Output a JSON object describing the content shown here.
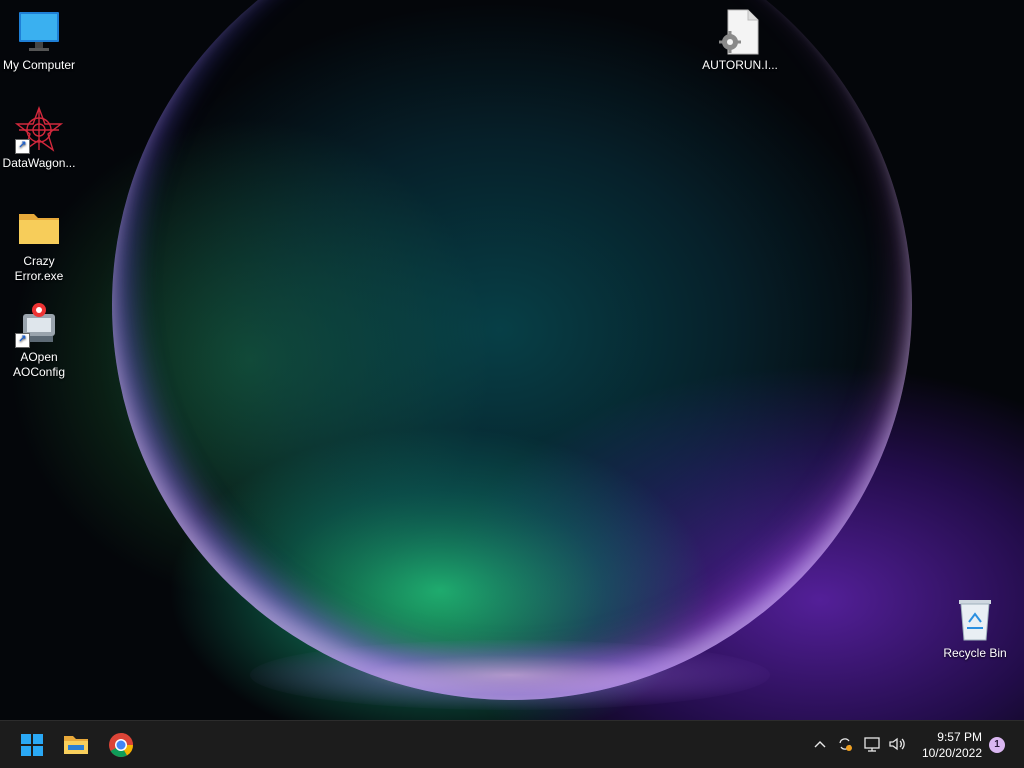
{
  "desktop": {
    "icons": [
      {
        "label": "My Computer",
        "icon": "monitor-icon"
      },
      {
        "label": "DataWagon...",
        "icon": "datawagon-star-icon"
      },
      {
        "label": "Crazy Error.exe",
        "icon": "folder-icon"
      },
      {
        "label": "AOpen AOConfig",
        "icon": "aopen-config-icon"
      },
      {
        "label": "AUTORUN.I...",
        "icon": "settings-file-icon"
      },
      {
        "label": "Recycle Bin",
        "icon": "recycle-bin-icon"
      }
    ]
  },
  "taskbar": {
    "start_icon": "windows-logo-icon",
    "pinned": [
      "file-explorer-icon",
      "chrome-icon"
    ],
    "tray": [
      "chevron-up-icon",
      "sync-icon",
      "network-icon",
      "volume-icon"
    ],
    "clock": {
      "time": "9:57 PM",
      "date": "10/20/2022"
    },
    "notification_count": "1"
  },
  "colors": {
    "taskbar_bg": "#1c1c1c",
    "accent_green": "#28dc82",
    "accent_purple": "#6e28c8"
  }
}
